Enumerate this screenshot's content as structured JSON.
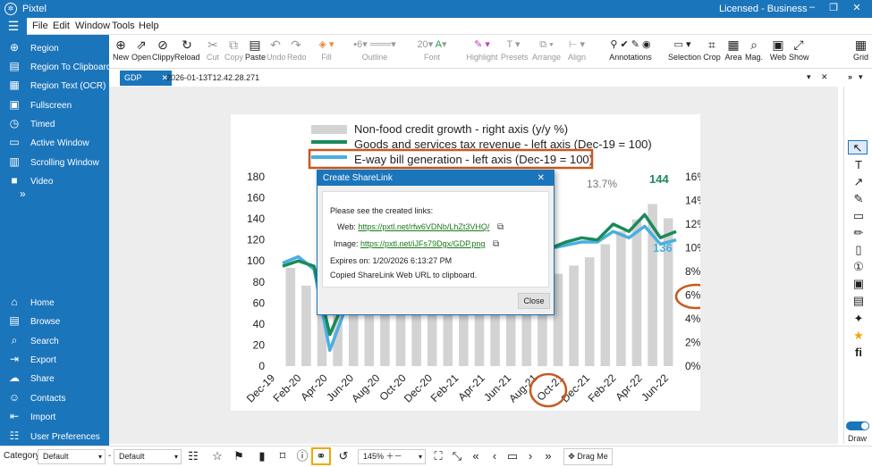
{
  "app": {
    "title": "Pixtel",
    "license": "Licensed - Business"
  },
  "menu": [
    "File",
    "Edit",
    "Window",
    "Tools",
    "Help"
  ],
  "sidebar": {
    "capture": [
      {
        "label": "Region",
        "icon": "plus-circle-icon"
      },
      {
        "label": "Region To Clipboard",
        "icon": "clipboard-icon"
      },
      {
        "label": "Region Text (OCR)",
        "icon": "ocr-icon"
      },
      {
        "label": "Fullscreen",
        "icon": "fullscreen-icon"
      },
      {
        "label": "Timed",
        "icon": "timer-icon"
      },
      {
        "label": "Active Window",
        "icon": "window-icon"
      },
      {
        "label": "Scrolling Window",
        "icon": "scroll-icon"
      },
      {
        "label": "Video",
        "icon": "video-icon"
      }
    ],
    "nav": [
      {
        "label": "Home",
        "icon": "home-icon"
      },
      {
        "label": "Browse",
        "icon": "browse-icon"
      },
      {
        "label": "Search",
        "icon": "search-icon"
      },
      {
        "label": "Export",
        "icon": "export-icon"
      },
      {
        "label": "Share",
        "icon": "share-icon"
      },
      {
        "label": "Contacts",
        "icon": "contacts-icon"
      },
      {
        "label": "Import",
        "icon": "import-icon"
      },
      {
        "label": "User Preferences",
        "icon": "preferences-icon"
      }
    ]
  },
  "toolbar": {
    "new": "New",
    "open": "Open",
    "clippy": "Clippy",
    "reload": "Reload",
    "cut": "Cut",
    "copy": "Copy",
    "paste": "Paste",
    "undo": "Undo",
    "redo": "Redo",
    "fill": "Fill",
    "outline": "Outline",
    "outline_width": "6",
    "font_size": "20",
    "font": "Font",
    "highlight": "Highlight",
    "presets": "Presets",
    "arrange": "Arrange",
    "align": "Align",
    "annotations": "Annotations",
    "selection": "Selection",
    "crop": "Crop",
    "area": "Area",
    "mag": "Mag.",
    "web": "Web",
    "show": "Show",
    "grid": "Grid"
  },
  "tabs": [
    {
      "label": "GDP"
    }
  ],
  "document_title": "2026-01-13T12.42.28.271",
  "chart_data": {
    "type": "bar",
    "legend": [
      "Non-food credit growth - right axis (y/y %)",
      "Goods and services tax revenue - left axis (Dec-19 = 100)",
      "E-way bill generation - left axis (Dec-19 = 100)"
    ],
    "x_labels": [
      "Dec-19",
      "Feb-20",
      "Apr-20",
      "Jun-20",
      "Aug-20",
      "Oct-20",
      "Dec-20",
      "Feb-21",
      "Apr-21",
      "Jun-21",
      "Aug-21",
      "Oct-21",
      "Dec-21",
      "Feb-22",
      "Apr-22",
      "Jun-22"
    ],
    "left_ticks": [
      "180",
      "160",
      "140",
      "120",
      "100",
      "80",
      "60",
      "40",
      "20",
      "0"
    ],
    "right_ticks": [
      "16%",
      "14%",
      "12%",
      "10%",
      "8%",
      "6%",
      "4%",
      "2%",
      "0%"
    ],
    "bars": [
      8.3,
      6.8,
      6.1,
      6.0,
      5.9,
      5.5,
      5.6,
      5.6,
      5.3,
      5.9,
      6.0,
      6.0,
      6.7,
      7.2,
      7.3,
      7.5,
      7.4,
      7.8,
      8.5,
      9.2,
      10.3,
      11.4,
      12.4,
      13.7,
      12.5
    ],
    "gst": [
      95,
      100,
      95,
      30,
      65,
      75,
      88,
      92,
      105,
      110,
      112,
      114,
      118,
      120,
      105,
      90,
      110,
      112,
      118,
      122,
      120,
      135,
      128,
      144,
      122,
      128
    ],
    "eway": [
      98,
      104,
      92,
      15,
      55,
      80,
      92,
      98,
      104,
      106,
      108,
      110,
      112,
      116,
      100,
      85,
      108,
      112,
      115,
      118,
      118,
      128,
      122,
      133,
      116,
      120
    ],
    "annotations": [
      "13.7%",
      "144",
      "136",
      "6%"
    ],
    "ylim_left": [
      0,
      180
    ],
    "ylim_right": [
      0,
      16
    ],
    "colors": {
      "bar": "#d3d3d3",
      "gst": "#1a8a5a",
      "eway": "#4aaee0",
      "highlight": "#c8581e"
    }
  },
  "dialog": {
    "title": "Create ShareLink",
    "intro": "Please see the created links:",
    "web_label": "Web:",
    "web_url": "https://pxtl.net/rfw6VDNb/LhZt3VHQ/",
    "image_label": "Image:",
    "image_url": "https://pxtl.net/iJFs79Dgx/GDP.png",
    "expires": "Expires on: 1/20/2026 6:13:27 PM",
    "copied": "Copied ShareLink Web URL to clipboard.",
    "close": "Close"
  },
  "right_tools_draw": "Draw",
  "status": {
    "category_label": "Category",
    "category_value": "Default",
    "style_value": "Default",
    "zoom": "145%",
    "drag_me": "Drag Me"
  }
}
